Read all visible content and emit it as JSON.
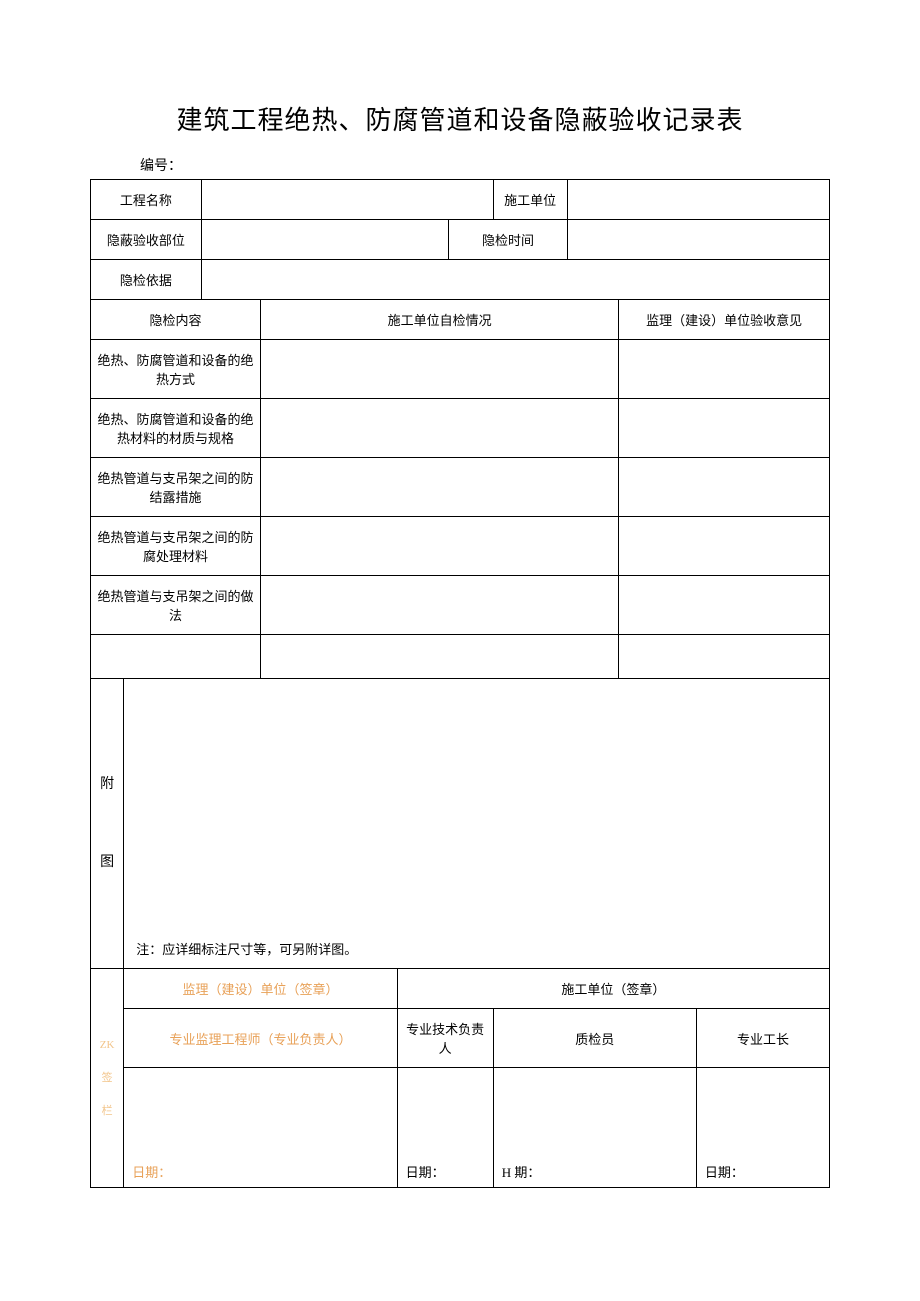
{
  "title": "建筑工程绝热、防腐管道和设备隐蔽验收记录表",
  "serial_label": "编号：",
  "header": {
    "project_name_label": "工程名称",
    "project_name_value": "",
    "construction_unit_label": "施工单位",
    "construction_unit_value": "",
    "hidden_accept_part_label": "隐蔽验收部位",
    "hidden_accept_part_value": "",
    "hidden_check_time_label": "隐检时间",
    "hidden_check_time_value": "",
    "hidden_check_basis_label": "隐检依据",
    "hidden_check_basis_value": ""
  },
  "section_headers": {
    "check_content": "隐检内容",
    "self_check": "施工单位自检情况",
    "supervisor_opinion": "监理（建设）单位验收意见"
  },
  "rows": [
    {
      "label": "绝热、防腐管道和设备的绝热方式",
      "self": "",
      "opinion": ""
    },
    {
      "label": "绝热、防腐管道和设备的绝热材料的材质与规格",
      "self": "",
      "opinion": ""
    },
    {
      "label": "绝热管道与支吊架之间的防结露措施",
      "self": "",
      "opinion": ""
    },
    {
      "label": "绝热管道与支吊架之间的防腐处理材料",
      "self": "",
      "opinion": ""
    },
    {
      "label": "绝热管道与支吊架之间的做法",
      "self": "",
      "opinion": ""
    },
    {
      "label": "",
      "self": "",
      "opinion": ""
    }
  ],
  "attachment": {
    "side_label_1": "附",
    "side_label_2": "图",
    "note": "注：应详细标注尺寸等，可另附详图。"
  },
  "signature": {
    "side_label_top": "ZK",
    "side_label_1": "签",
    "side_label_2": "栏",
    "supervisor_unit_seal": "监理（建设）单位（签章）",
    "construction_unit_seal": "施工单位（签章）",
    "pro_supervisor_engineer": "专业监理工程师（专业负责人）",
    "tech_lead": "专业技术负责人",
    "quality_inspector": "质检员",
    "foreman": "专业工长",
    "date1": "日期：",
    "date2": "日期：",
    "date3": "H 期：",
    "date4": "日期："
  }
}
